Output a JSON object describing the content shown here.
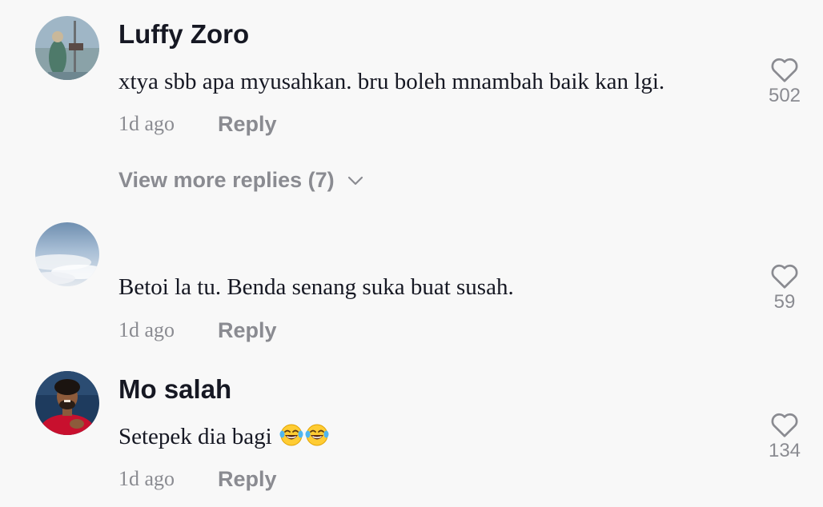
{
  "comments": [
    {
      "username": "Luffy Zoro",
      "text": "xtya sbb apa myusahkan. bru boleh mnambah baik kan lgi.",
      "time": "1d ago",
      "reply_label": "Reply",
      "likes": "502"
    },
    {
      "username": "",
      "text": "Betoi la tu. Benda senang suka buat susah.",
      "time": "1d ago",
      "reply_label": "Reply",
      "likes": "59"
    },
    {
      "username": "Mo salah",
      "text": "Setepek dia bagi",
      "emoji": "😂😂",
      "time": "1d ago",
      "reply_label": "Reply",
      "likes": "134"
    }
  ],
  "view_more": {
    "label": "View more replies (7)"
  },
  "colors": {
    "background": "#f8f8f8",
    "primary_text": "#161823",
    "secondary_text": "#8a8b91"
  },
  "icons": {
    "like": "heart-outline-icon",
    "expand": "chevron-down-icon"
  }
}
